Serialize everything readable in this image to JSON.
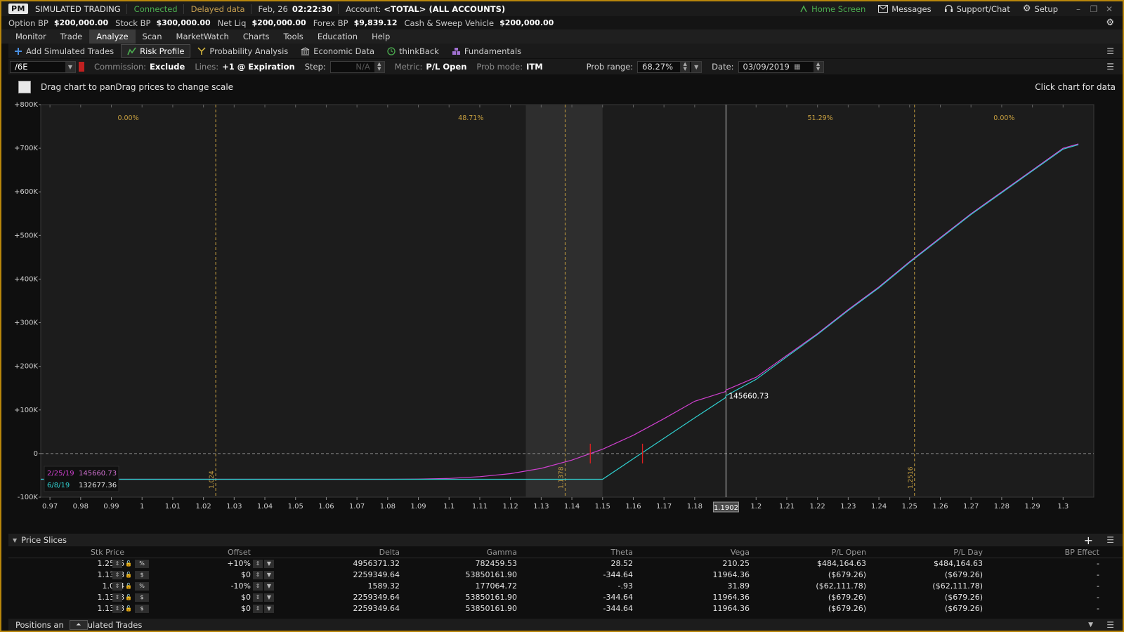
{
  "titlebar": {
    "badge": "PM",
    "mode": "SIMULATED TRADING",
    "status": "Connected",
    "data_mode": "Delayed data",
    "date": "Feb, 26",
    "time": "02:22:30",
    "account_label": "Account:",
    "account_value": "<TOTAL> (ALL ACCOUNTS)",
    "home": "Home Screen",
    "messages": "Messages",
    "support": "Support/Chat",
    "setup": "Setup",
    "colors": {
      "status": "#4caf50",
      "data_mode": "#c8a050",
      "home": "#4caf50"
    }
  },
  "balances": [
    {
      "label": "Option BP",
      "value": "$200,000.00"
    },
    {
      "label": "Stock BP",
      "value": "$300,000.00"
    },
    {
      "label": "Net Liq",
      "value": "$200,000.00"
    },
    {
      "label": "Forex BP",
      "value": "$9,839.12"
    },
    {
      "label": "Cash & Sweep Vehicle",
      "value": "$200,000.00"
    }
  ],
  "menu": [
    "Monitor",
    "Trade",
    "Analyze",
    "Scan",
    "MarketWatch",
    "Charts",
    "Tools",
    "Education",
    "Help"
  ],
  "menu_active": "Analyze",
  "subtabs": [
    {
      "label": "Add Simulated Trades",
      "icon": "plus-icon"
    },
    {
      "label": "Risk Profile",
      "icon": "risk-profile-icon",
      "active": true
    },
    {
      "label": "Probability Analysis",
      "icon": "probability-icon"
    },
    {
      "label": "Economic Data",
      "icon": "bank-icon"
    },
    {
      "label": "thinkBack",
      "icon": "history-icon"
    },
    {
      "label": "Fundamentals",
      "icon": "fundamentals-icon"
    }
  ],
  "controls": {
    "symbol": "/6E",
    "commission_label": "Commission:",
    "commission_value": "Exclude",
    "lines_label": "Lines:",
    "lines_value": "+1 @ Expiration",
    "step_label": "Step:",
    "step_value": "N/A",
    "metric_label": "Metric:",
    "metric_value": "P/L Open",
    "probmode_label": "Prob mode:",
    "probmode_value": "ITM",
    "probrange_label": "Prob range:",
    "probrange_value": "68.27%",
    "date_label": "Date:",
    "date_value": "03/09/2019"
  },
  "chart_header": {
    "hint": "Drag chart to panDrag prices to change scale",
    "right_hint": "Click chart for data"
  },
  "chart_data": {
    "type": "line",
    "x_ticks": [
      "0.97",
      "0.98",
      "0.99",
      "1",
      "1.01",
      "1.02",
      "1.03",
      "1.04",
      "1.05",
      "1.06",
      "1.07",
      "1.08",
      "1.09",
      "1.1",
      "1.11",
      "1.12",
      "1.13",
      "1.14",
      "1.15",
      "1.16",
      "1.17",
      "1.18",
      "1.19",
      "1.2",
      "1.21",
      "1.22",
      "1.23",
      "1.24",
      "1.25",
      "1.26",
      "1.27",
      "1.28",
      "1.29",
      "1.3"
    ],
    "y_ticks": [
      "+800K",
      "+700K",
      "+600K",
      "+500K",
      "+400K",
      "+300K",
      "+200K",
      "+100K",
      "0",
      "-100K"
    ],
    "xlim": [
      0.967,
      1.31
    ],
    "ylim": [
      -100000,
      800000
    ],
    "series": [
      {
        "name": "2/25/19",
        "color": "#d040d0",
        "x": [
          0.967,
          1.08,
          1.09,
          1.1,
          1.11,
          1.12,
          1.13,
          1.14,
          1.15,
          1.16,
          1.17,
          1.18,
          1.19,
          1.1902,
          1.2,
          1.21,
          1.22,
          1.23,
          1.24,
          1.25,
          1.26,
          1.27,
          1.28,
          1.29,
          1.3,
          1.305
        ],
        "y": [
          -59000,
          -59000,
          -58500,
          -57000,
          -53000,
          -46000,
          -34000,
          -15000,
          10000,
          42000,
          80000,
          120000,
          142000,
          145660.73,
          175000,
          225000,
          275000,
          330000,
          382000,
          440000,
          495000,
          550000,
          600000,
          650000,
          700000,
          710000
        ]
      },
      {
        "name": "6/8/19",
        "color": "#30d0d0",
        "x": [
          0.967,
          1.15,
          1.16,
          1.17,
          1.18,
          1.19,
          1.1902,
          1.2,
          1.21,
          1.22,
          1.23,
          1.24,
          1.25,
          1.26,
          1.27,
          1.28,
          1.29,
          1.3,
          1.305
        ],
        "y": [
          -59000,
          -59000,
          -12000,
          35000,
          82000,
          128000,
          132677.36,
          170000,
          222000,
          273000,
          328000,
          380000,
          438000,
          493000,
          548000,
          598000,
          648000,
          698000,
          708000
        ]
      }
    ],
    "vertical_lines": [
      {
        "x": 1.024,
        "label": "1.024"
      },
      {
        "x": 1.1378,
        "label": "1.1378"
      },
      {
        "x": 1.2516,
        "label": "1.2516"
      }
    ],
    "probabilities": [
      "0.00%",
      "48.71%",
      "51.29%",
      "0.00%"
    ],
    "shaded_range": [
      1.125,
      1.15
    ],
    "cursor": {
      "x": 1.1902,
      "label": "1.1902",
      "value": "145660.73"
    },
    "breakevens": [
      1.146,
      1.163
    ],
    "legend": [
      {
        "date": "2/25/19",
        "value": "145660.73"
      },
      {
        "date": "6/8/19",
        "value": "132677.36"
      }
    ]
  },
  "slices": {
    "title": "Price Slices",
    "headers": [
      "Stk Price",
      "Offset",
      "Delta",
      "Gamma",
      "Theta",
      "Vega",
      "P/L Open",
      "P/L Day",
      "BP Effect"
    ],
    "rows": [
      {
        "price": "1.2516",
        "unit": "%",
        "offset": "+10%",
        "delta": "4956371.32",
        "gamma": "782459.53",
        "theta": "28.52",
        "vega": "210.25",
        "plopen": "$484,164.63",
        "plday": "$484,164.63",
        "bp": "-"
      },
      {
        "price": "1.1378",
        "unit": "$",
        "offset": "$0",
        "delta": "2259349.64",
        "gamma": "53850161.90",
        "theta": "-344.64",
        "vega": "11964.36",
        "plopen": "($679.26)",
        "plday": "($679.26)",
        "bp": "-"
      },
      {
        "price": "1.024",
        "unit": "%",
        "offset": "-10%",
        "delta": "1589.32",
        "gamma": "177064.72",
        "theta": "-.93",
        "vega": "31.89",
        "plopen": "($62,111.78)",
        "plday": "($62,111.78)",
        "bp": "-"
      },
      {
        "price": "1.1378",
        "unit": "$",
        "offset": "$0",
        "delta": "2259349.64",
        "gamma": "53850161.90",
        "theta": "-344.64",
        "vega": "11964.36",
        "plopen": "($679.26)",
        "plday": "($679.26)",
        "bp": "-"
      },
      {
        "price": "1.1378",
        "unit": "$",
        "offset": "$0",
        "delta": "2259349.64",
        "gamma": "53850161.90",
        "theta": "-344.64",
        "vega": "11964.36",
        "plopen": "($679.26)",
        "plday": "($679.26)",
        "bp": "-"
      }
    ]
  },
  "bottom": {
    "left": "Positions an",
    "right": "ulated Trades"
  }
}
